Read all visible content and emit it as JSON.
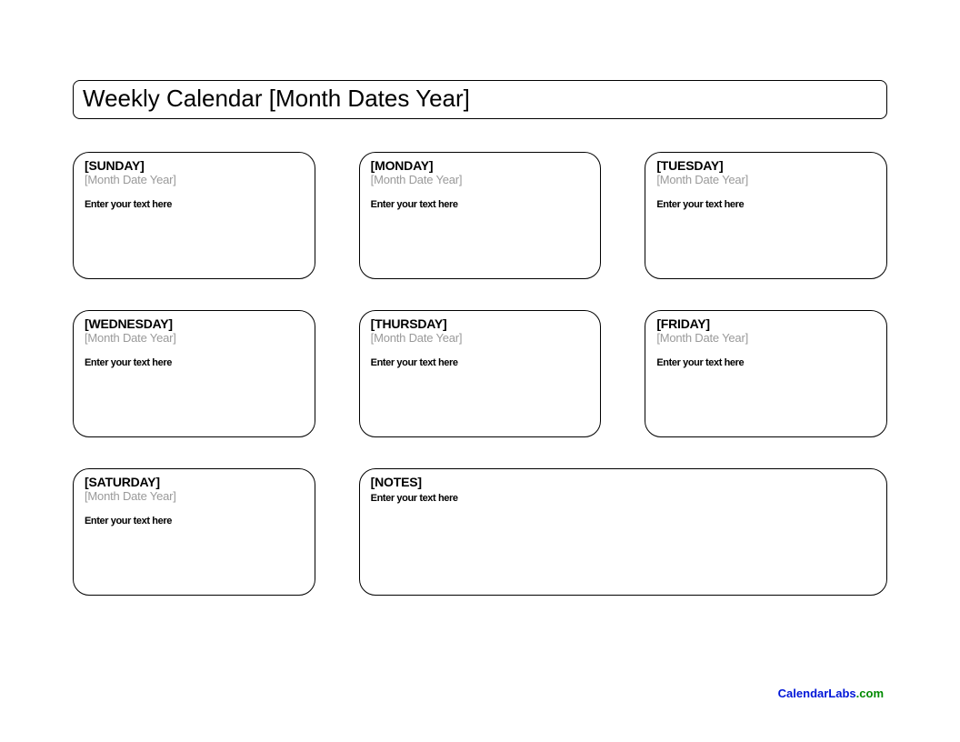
{
  "title": "Weekly Calendar [Month Dates Year]",
  "days": [
    {
      "name": "[SUNDAY]",
      "sub": "[Month Date Year]",
      "text": "Enter your text here"
    },
    {
      "name": "[MONDAY]",
      "sub": "[Month Date Year]",
      "text": "Enter your text here"
    },
    {
      "name": "[TUESDAY]",
      "sub": "[Month Date Year]",
      "text": "Enter your text here"
    },
    {
      "name": "[WEDNESDAY]",
      "sub": "[Month Date Year]",
      "text": "Enter your text here"
    },
    {
      "name": "[THURSDAY]",
      "sub": "[Month Date Year]",
      "text": "Enter your text here"
    },
    {
      "name": "[FRIDAY]",
      "sub": "[Month Date Year]",
      "text": "Enter your text here"
    },
    {
      "name": "[SATURDAY]",
      "sub": "[Month Date Year]",
      "text": "Enter your text here"
    }
  ],
  "notes": {
    "name": "[NOTES]",
    "text": "Enter your text here"
  },
  "footer": {
    "brand": "CalendarLabs",
    "suffix": ".com"
  }
}
